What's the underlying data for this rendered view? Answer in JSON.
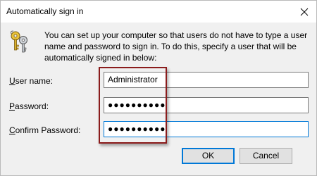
{
  "window": {
    "title": "Automatically sign in"
  },
  "description": "You can set up your computer so that users do not have to type a user name and password to sign in. To do this, specify a user that will be automatically signed in below:",
  "fields": {
    "user_name": {
      "label_accel": "U",
      "label_rest": "ser name:",
      "value": "Administrator"
    },
    "password": {
      "label_accel": "P",
      "label_rest": "assword:",
      "value": "●●●●●●●●●●"
    },
    "confirm_password": {
      "label_accel": "C",
      "label_rest": "onfirm Password:",
      "value": "●●●●●●●●●●"
    }
  },
  "buttons": {
    "ok": "OK",
    "cancel": "Cancel"
  },
  "colors": {
    "highlight_box": "#8b1c1c",
    "focus_border": "#0078d7"
  },
  "icons": {
    "title_close": "close-icon",
    "keys": "keys-icon"
  }
}
